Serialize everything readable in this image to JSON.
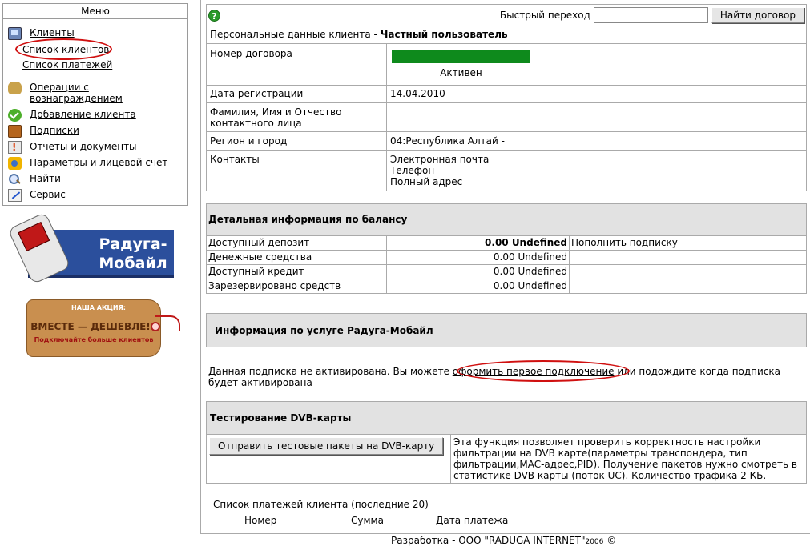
{
  "sidebar": {
    "title": "Меню",
    "items": [
      {
        "label": "Клиенты",
        "icon": "clients-icon"
      },
      {
        "label": "Операции с вознаграждением",
        "icon": "money-bag-icon"
      },
      {
        "label": "Добавление клиента",
        "icon": "green-check-icon"
      },
      {
        "label": "Подписки",
        "icon": "subscriptions-icon"
      },
      {
        "label": "Отчеты и документы",
        "icon": "reports-icon"
      },
      {
        "label": "Параметры и лицевой счет",
        "icon": "params-icon"
      },
      {
        "label": "Найти",
        "icon": "magnifier-icon"
      },
      {
        "label": "Сервис",
        "icon": "service-icon"
      }
    ],
    "subitems": [
      {
        "label": "Список клиентов"
      },
      {
        "label": "Список платежей"
      }
    ],
    "ops_line1": "Операции с",
    "ops_line2": "вознаграждением"
  },
  "banners": {
    "raduga_mobile": "Радуга-Мобайл",
    "action_top": "НАША АКЦИЯ:",
    "action_main": "ВМЕСТЕ — ДЕШЕВЛЕ!",
    "action_sub": "Подключайте больше клиентов"
  },
  "quick": {
    "label": "Быстрый переход",
    "input_value": "",
    "button": "Найти договор"
  },
  "personal": {
    "title_prefix": "Персональные данные клиента - ",
    "title_bold": "Частный пользователь",
    "rows": [
      {
        "label": "Номер договора",
        "value": ""
      },
      {
        "label": "Дата регистрации",
        "value": "14.04.2010"
      },
      {
        "label": "Фамилия, Имя и Отчество контактного лица",
        "value": ""
      },
      {
        "label": "Регион и город",
        "value": "04:Республика Алтай -"
      },
      {
        "label": "Контакты",
        "value": ""
      }
    ],
    "status": "Активен",
    "status_color": "#0e8a1c",
    "contacts": [
      "Электронная почта",
      "Телефон",
      "Полный адрес"
    ]
  },
  "balance": {
    "title": "Детальная информация по балансу",
    "rows": [
      {
        "label": "Доступный депозит",
        "value": "0.00 Undefined",
        "action": "Пополнить подписку"
      },
      {
        "label": "Денежные средства",
        "value": "0.00 Undefined",
        "action": ""
      },
      {
        "label": "Доступный кредит",
        "value": "0.00 Undefined",
        "action": ""
      },
      {
        "label": "Зарезервировано средств",
        "value": "0.00 Undefined",
        "action": ""
      }
    ]
  },
  "service": {
    "title": "Информация по услуге Радуга-Мобайл",
    "notice_before": "Данная подписка не активирована. Вы можете ",
    "notice_link": "оформить первое подключение",
    "notice_after": " или подождите когда подписка будет активирована"
  },
  "dvb": {
    "title": "Тестирование DVB-карты",
    "button": "Отправить тестовые пакеты на DVB-карту",
    "description": "Эта функция позволяет проверить корректность настройки фильтрации на DVB карте(параметры транспондера, тип фильтрации,MAC-адрес,PID). Получение пакетов нужно смотреть в статистике DVB карты (поток UC). Количество трафика 2 КБ."
  },
  "payments": {
    "title": "Список платежей клиента (последние 20)",
    "columns": [
      "Номер",
      "Сумма",
      "Дата платежа"
    ]
  },
  "footer": {
    "text": "Разработка - ООО \"RADUGA INTERNET\"",
    "year": "2006",
    "copyright": "©"
  },
  "colors": {
    "highlight_oval": "#d01010",
    "section_header_bg": "#e2e2e2"
  }
}
